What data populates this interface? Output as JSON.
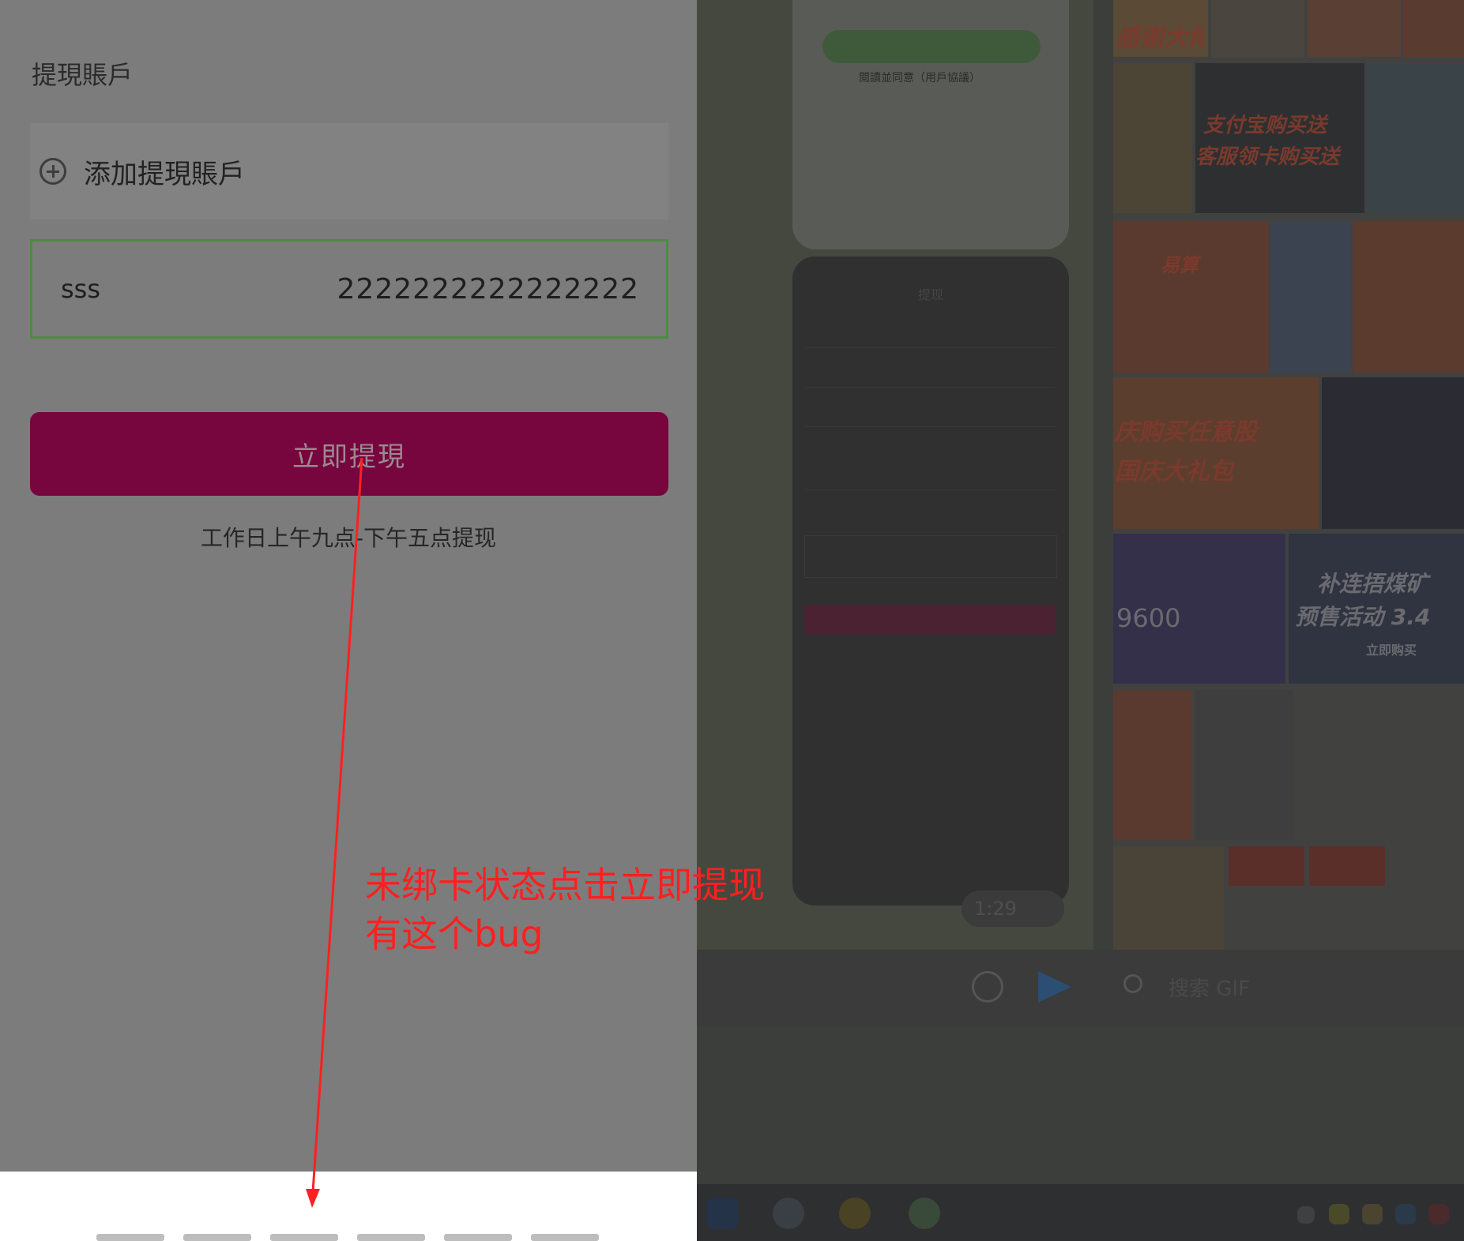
{
  "withdraw_screen": {
    "section_title": "提現賬戶",
    "add_account_label": "添加提現賬戶",
    "account": {
      "name": "sss",
      "number": "2222222222222222"
    },
    "submit_label": "立即提現",
    "hint": "工作日上午九点-下午五点提现"
  },
  "annotation": {
    "line1": "未绑卡状态点击立即提现",
    "line2": "有这个bug"
  },
  "desktop": {
    "top_caption": "閱讀並同意（用戶協議）",
    "thumb_title": "提现",
    "timestamp": "1:29",
    "gif_search_placeholder": "搜索 GIF",
    "gif_tiles": [
      {
        "text": "感谢大佬"
      },
      {
        "text": "支付宝购买送"
      },
      {
        "text": "客服领卡购买送"
      },
      {
        "text": "易算"
      },
      {
        "text": "庆购买任意股"
      },
      {
        "text": "国庆大礼包"
      },
      {
        "text": "补连捂煤矿"
      },
      {
        "text": "预售活动 3.4"
      },
      {
        "text": "9600"
      },
      {
        "text": "立即购买"
      }
    ]
  },
  "colors": {
    "submit_bg": "#77053e",
    "card_border": "#4f8a42",
    "annotation": "#ff1f1f"
  }
}
